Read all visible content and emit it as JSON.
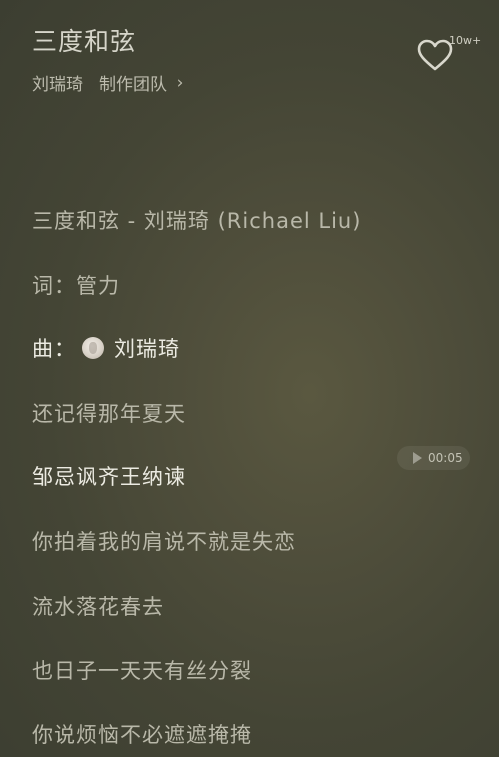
{
  "header": {
    "title": "三度和弦",
    "artist": "刘瑞琦",
    "team_label": "制作团队",
    "team_chevron": "›"
  },
  "like": {
    "icon": "heart-outline-icon",
    "count": "10w+"
  },
  "lyrics": {
    "heading": "三度和弦 - 刘瑞琦 (Richael Liu)",
    "lyricist_label": "词：",
    "lyricist": "管力",
    "composer_label": "曲：",
    "composer": "刘瑞琦",
    "lines": [
      "还记得那年夏天",
      "邹忌讽齐王纳谏",
      "你拍着我的肩说不就是失恋",
      "流水落花春去",
      "也日子一天天有丝分裂",
      "你说烦恼不必遮遮掩掩"
    ]
  },
  "playback": {
    "seek_time": "00:05",
    "play_icon": "play-icon"
  },
  "colors": {
    "background": "#4b4b3a",
    "text_active": "#ecebe2",
    "text_inactive": "#b9b8a9"
  }
}
